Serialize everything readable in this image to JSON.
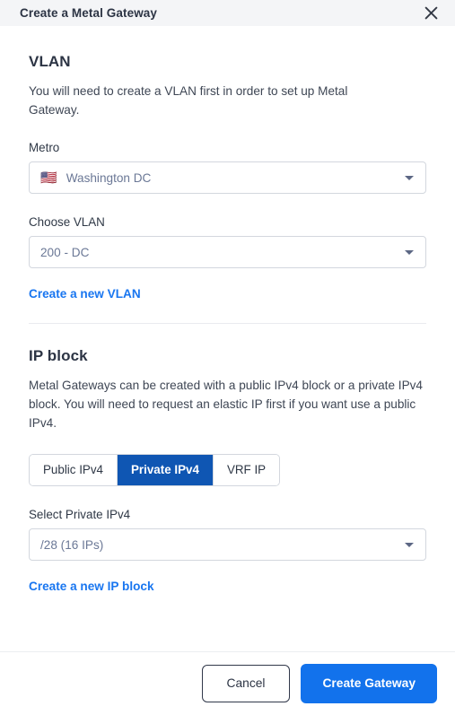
{
  "header": {
    "title": "Create a Metal Gateway",
    "close_icon": "close-icon"
  },
  "vlan_section": {
    "title": "VLAN",
    "description": "You will need to create a VLAN first in order to set up Metal Gateway.",
    "metro": {
      "label": "Metro",
      "value": "Washington DC",
      "flag": "🇺🇸"
    },
    "vlan": {
      "label": "Choose VLAN",
      "value": "200 - DC"
    },
    "create_link": "Create a new VLAN"
  },
  "ip_block_section": {
    "title": "IP block",
    "description": "Metal Gateways can be created with a public IPv4 block or a private IPv4 block. You will need to request an elastic IP first if you want use a public IPv4.",
    "tabs": [
      {
        "label": "Public IPv4",
        "active": false
      },
      {
        "label": "Private IPv4",
        "active": true
      },
      {
        "label": "VRF IP",
        "active": false
      }
    ],
    "select": {
      "label": "Select Private IPv4",
      "value": "/28 (16 IPs)"
    },
    "create_link": "Create a new IP block"
  },
  "footer": {
    "cancel_label": "Cancel",
    "submit_label": "Create Gateway"
  },
  "colors": {
    "accent_link": "#1976f0",
    "tab_active": "#0f56b3",
    "primary_button": "#1272ec",
    "header_bg": "#f4f5f7",
    "border": "#d3d7de"
  }
}
